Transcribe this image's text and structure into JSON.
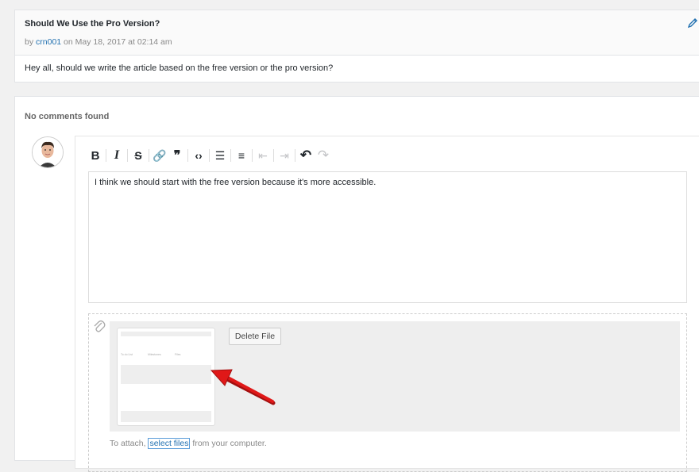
{
  "topic": {
    "title": "Should We Use the Pro Version?",
    "meta_prefix": "by ",
    "author": "crn001",
    "meta_suffix": " on May 18, 2017 at 02:14 am",
    "body": "Hey all, should we write the article based on the free version or the pro version?",
    "edit_icon": "pencil-icon"
  },
  "comments": {
    "empty_text": "No comments found"
  },
  "editor": {
    "toolbar": [
      {
        "name": "bold-button",
        "glyph": "B",
        "disabled": false
      },
      {
        "name": "italic-button",
        "glyph": "I",
        "disabled": false
      },
      {
        "name": "strikethrough-button",
        "glyph": "S",
        "disabled": false
      },
      {
        "name": "link-button",
        "glyph": "🔗",
        "disabled": false
      },
      {
        "name": "blockquote-button",
        "glyph": "❞",
        "disabled": false
      },
      {
        "name": "code-button",
        "glyph": "‹›",
        "disabled": false
      },
      {
        "name": "bullet-list-button",
        "glyph": "☰",
        "disabled": false
      },
      {
        "name": "numbered-list-button",
        "glyph": "≡",
        "disabled": false
      },
      {
        "name": "outdent-button",
        "glyph": "⇤",
        "disabled": true
      },
      {
        "name": "indent-button",
        "glyph": "⇥",
        "disabled": true
      },
      {
        "name": "undo-button",
        "glyph": "↶",
        "disabled": false
      },
      {
        "name": "redo-button",
        "glyph": "↷",
        "disabled": true
      }
    ],
    "content": "I think we should start with the free version because it's more accessible."
  },
  "attachments": {
    "delete_label": "Delete File",
    "hint_prefix": "To attach, ",
    "hint_link": "select files",
    "hint_suffix": " from your computer.",
    "thumb_labels": [
      "To do List",
      "Milestones",
      "Files"
    ]
  },
  "colors": {
    "link": "#2271b1",
    "arrow": "#e01818"
  }
}
